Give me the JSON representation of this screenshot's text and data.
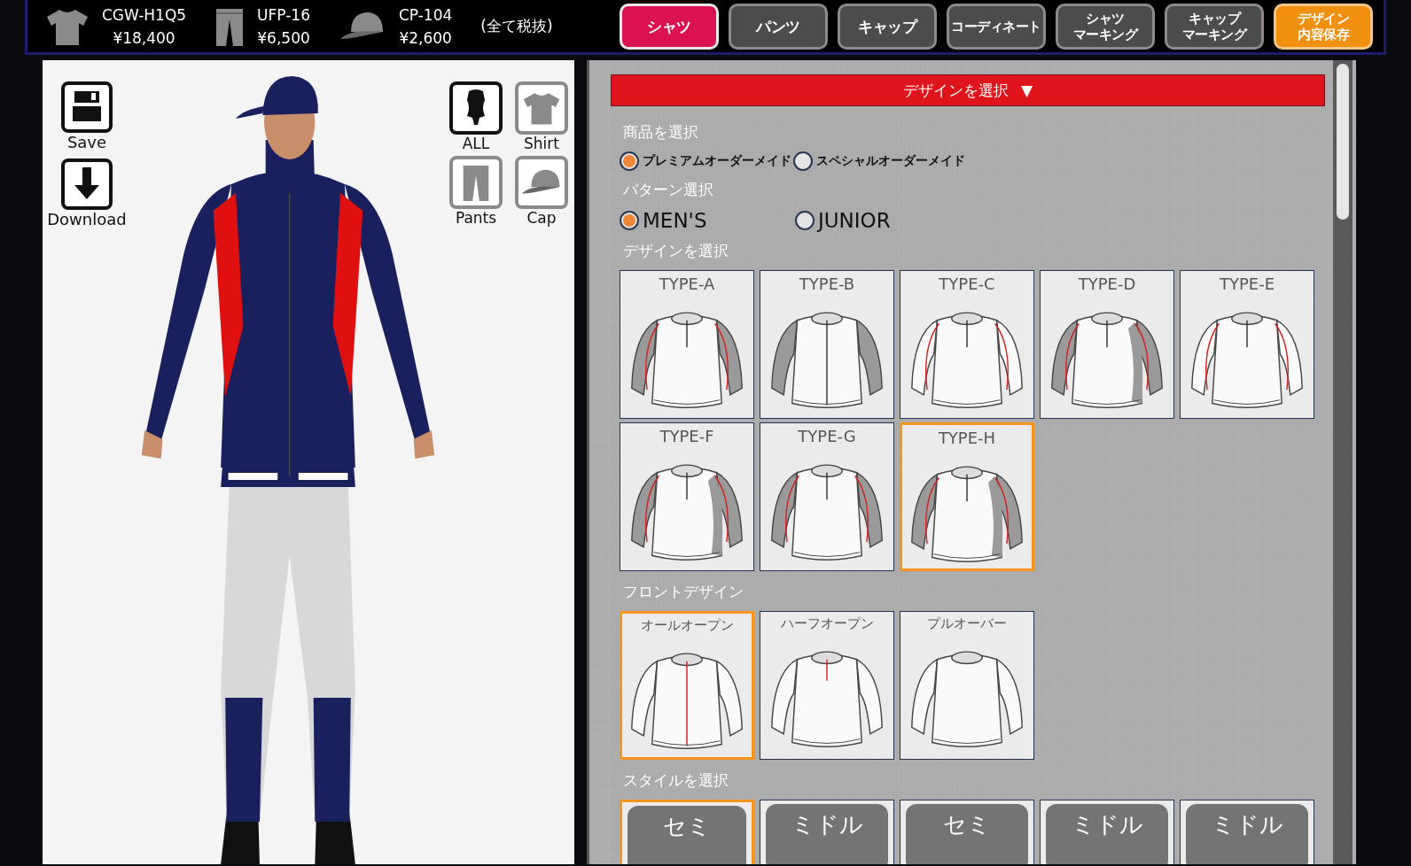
{
  "cart": {
    "items": [
      {
        "kind": "shirt",
        "code": "CGW-H1Q5",
        "price": "¥18,400"
      },
      {
        "kind": "pants",
        "code": "UFP-16",
        "price": "¥6,500"
      },
      {
        "kind": "cap",
        "code": "CP-104",
        "price": "¥2,600"
      }
    ],
    "tax_note": "(全て税抜)"
  },
  "nav_tabs": [
    {
      "lines": [
        "シャツ"
      ],
      "selected": true
    },
    {
      "lines": [
        "パンツ"
      ],
      "selected": false
    },
    {
      "lines": [
        "キャップ"
      ],
      "selected": false
    },
    {
      "lines": [
        "コーディネート"
      ],
      "selected": false
    },
    {
      "lines": [
        "シャツ",
        "マーキング"
      ],
      "selected": false
    },
    {
      "lines": [
        "キャップ",
        "マーキング"
      ],
      "selected": false
    }
  ],
  "save_button": {
    "lines": [
      "デザイン",
      "内容保存"
    ]
  },
  "preview": {
    "actions": [
      {
        "kind": "save",
        "label": "Save"
      },
      {
        "kind": "download",
        "label": "Download"
      }
    ],
    "views": [
      {
        "kind": "all",
        "label": "ALL",
        "selected": true
      },
      {
        "kind": "shirt",
        "label": "Shirt",
        "selected": false
      },
      {
        "kind": "pants",
        "label": "Pants",
        "selected": false
      },
      {
        "kind": "cap",
        "label": "Cap",
        "selected": false
      }
    ]
  },
  "design_panel": {
    "dropdown": {
      "label": "デザインを選択",
      "caret": "▼"
    },
    "sections": [
      {
        "kind": "radio",
        "title": "商品を選択",
        "options": [
          {
            "label": "プレミアムオーダーメイド",
            "selected": true
          },
          {
            "label": "スペシャルオーダーメイド",
            "selected": false
          }
        ]
      },
      {
        "kind": "radio",
        "title": "パターン選択",
        "options": [
          {
            "label": "MEN'S",
            "selected": true
          },
          {
            "label": "JUNIOR",
            "selected": false
          }
        ]
      },
      {
        "kind": "thumbs",
        "title": "デザインを選択",
        "options": [
          {
            "label": "TYPE-A",
            "selected": false
          },
          {
            "label": "TYPE-B",
            "selected": false
          },
          {
            "label": "TYPE-C",
            "selected": false
          },
          {
            "label": "TYPE-D",
            "selected": false
          },
          {
            "label": "TYPE-E",
            "selected": false
          },
          {
            "label": "TYPE-F",
            "selected": false
          },
          {
            "label": "TYPE-G",
            "selected": false
          },
          {
            "label": "TYPE-H",
            "selected": true
          }
        ]
      },
      {
        "kind": "thumbs",
        "title": "フロントデザイン",
        "options": [
          {
            "label": "オールオープン",
            "selected": true
          },
          {
            "label": "ハーフオープン",
            "selected": false
          },
          {
            "label": "プルオーバー",
            "selected": false
          }
        ]
      },
      {
        "kind": "styles",
        "title": "スタイルを選択",
        "options": [
          {
            "label": "セミ",
            "selected": true
          },
          {
            "label": "ミドル",
            "selected": false
          },
          {
            "label": "セミ",
            "selected": false
          },
          {
            "label": "ミドル",
            "selected": false
          },
          {
            "label": "ミドル",
            "selected": false
          }
        ]
      }
    ]
  }
}
